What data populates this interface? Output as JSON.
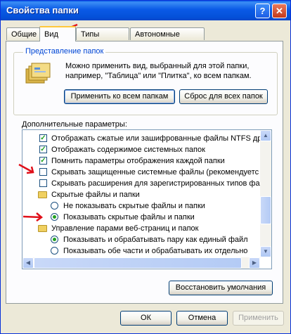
{
  "window": {
    "title": "Свойства папки"
  },
  "tabs": [
    {
      "label": "Общие"
    },
    {
      "label": "Вид"
    },
    {
      "label": "Типы файлов"
    },
    {
      "label": "Автономные файлы"
    }
  ],
  "folder_view": {
    "group_title": "Представление папок",
    "description": "Можно применить вид, выбранный для этой папки, например, \"Таблица\" или \"Плитка\", ко всем папкам.",
    "apply_all_label": "Применить ко всем папкам",
    "reset_all_label": "Сброс для всех папок"
  },
  "advanced": {
    "label": "Дополнительные параметры:",
    "items": [
      {
        "type": "checkbox",
        "checked": true,
        "label": "Отображать сжатые или зашифрованные файлы NTFS др"
      },
      {
        "type": "checkbox",
        "checked": true,
        "label": "Отображать содержимое системных папок"
      },
      {
        "type": "checkbox",
        "checked": true,
        "label": "Помнить параметры отображения каждой папки"
      },
      {
        "type": "checkbox",
        "checked": false,
        "label": "Скрывать защищенные системные файлы (рекомендуетс"
      },
      {
        "type": "checkbox",
        "checked": false,
        "label": "Скрывать расширения для зарегистрированных типов фа"
      },
      {
        "type": "folder",
        "label": "Скрытые файлы и папки"
      },
      {
        "type": "radio",
        "checked": false,
        "label": "Не показывать скрытые файлы и папки"
      },
      {
        "type": "radio",
        "checked": true,
        "label": "Показывать скрытые файлы и папки"
      },
      {
        "type": "folder",
        "label": "Управление парами веб-страниц и папок"
      },
      {
        "type": "radio",
        "checked": true,
        "label": "Показывать и обрабатывать пару как единый файл"
      },
      {
        "type": "radio",
        "checked": false,
        "label": "Показывать обе части и обрабатывать их отдельно"
      }
    ],
    "restore_label": "Восстановить умолчания"
  },
  "footer": {
    "ok_label": "ОК",
    "cancel_label": "Отмена",
    "apply_label": "Применить"
  },
  "colors": {
    "annotation_arrow": "#e0101a",
    "titlebar": "#0a5ae6"
  }
}
